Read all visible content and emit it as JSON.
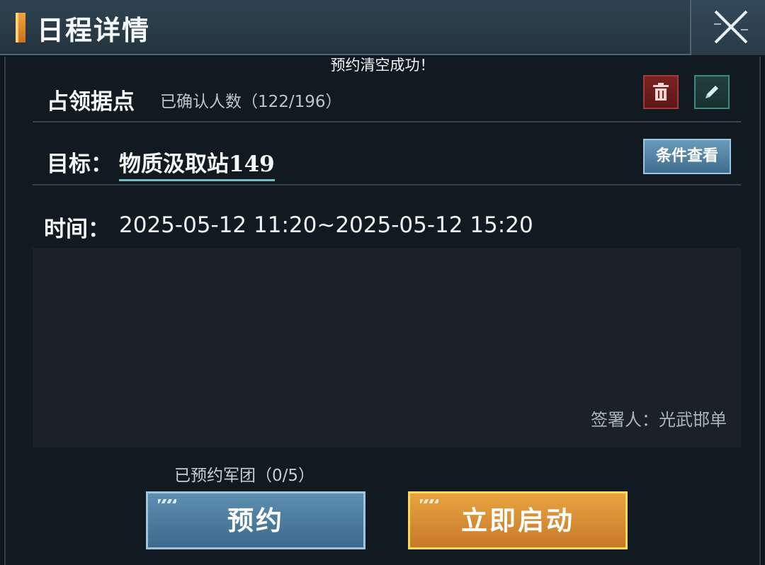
{
  "header": {
    "title": "日程详情"
  },
  "toast": "预约清空成功！",
  "event": {
    "name": "占领据点",
    "confirmed": "已确认人数（122/196）"
  },
  "target": {
    "label": "目标：",
    "value": "物质汲取站149",
    "button": "条件查看"
  },
  "time": {
    "label": "时间：",
    "value": "2025-05-12 11:20~2025-05-12 15:20"
  },
  "signer": "签署人：光武邯单",
  "reserved": "已预约军团（0/5）",
  "buttons": {
    "book": "预约",
    "start": "立即启动"
  },
  "icons": [
    "bracket-accent-icon",
    "close-icon",
    "trash-icon",
    "pencil-icon"
  ],
  "colors": {
    "delete": "#7b2222",
    "edit": "#22403d",
    "book": "#4a7c9e",
    "start": "#e09a3c"
  }
}
